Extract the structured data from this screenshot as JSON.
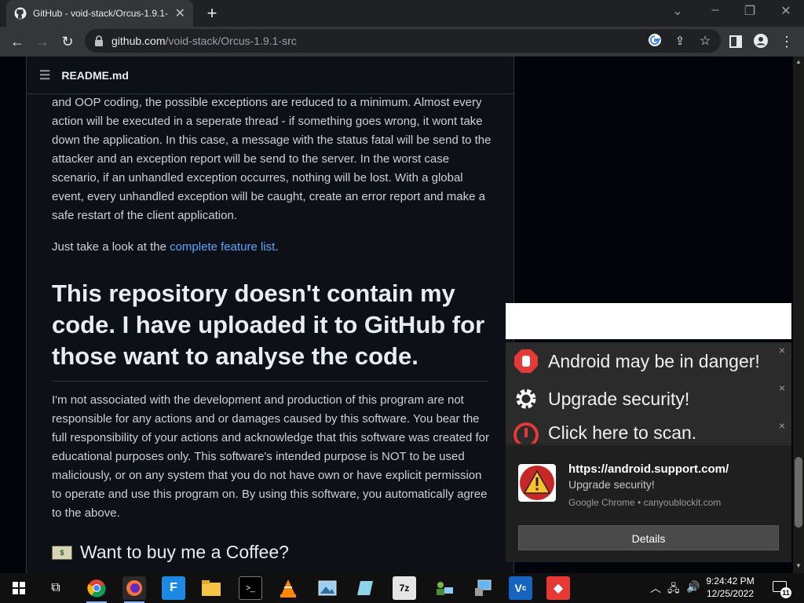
{
  "browser": {
    "tab_title": "GitHub - void-stack/Orcus-1.9.1-",
    "tab_close": "✕",
    "new_tab": "+",
    "url_host": "github.com",
    "url_path": "/void-stack/Orcus-1.9.1-src"
  },
  "readme": {
    "filename": "README.md",
    "para1": "and OOP coding, the possible exceptions are reduced to a minimum. Almost every action will be executed in a seperate thread - if something goes wrong, it wont take down the application. In this case, a message with the status fatal will be send to the attacker and an exception report will be send to the server. In the worst case scenario, if an unhandled exception occurres, nothing will be lost. With a global event, every unhandled exception will be caught, create an error report and make a safe restart of the client application.",
    "para2_prefix": "Just take a look at the ",
    "para2_link": "complete feature list",
    "para2_suffix": ".",
    "heading": "This repository doesn't contain my code. I have uploaded it to GitHub for those want to analyse the code.",
    "para3": "I'm not associated with the development and production of this program are not responsible for any actions and or damages caused by this software. You bear the full responsibility of your actions and acknowledge that this software was created for educational purposes only. This software's intended purpose is NOT to be used maliciously, or on any system that you do not have own or have explicit permission to operate and use this program on. By using this software, you automatically agree to the above.",
    "subheading": "Want to buy me a Coffee?"
  },
  "ad_popup": {
    "row1": "Android may be in danger!",
    "row2": "Upgrade security!",
    "row3": "Click here to scan.",
    "close": "×"
  },
  "notification": {
    "title": "https://android.support.com/",
    "body": "Upgrade security!",
    "source": "Google Chrome • canyoublockit.com",
    "button": "Details"
  },
  "taskbar": {
    "time": "9:24:42 PM",
    "date": "12/25/2022",
    "notif_count": "11"
  }
}
